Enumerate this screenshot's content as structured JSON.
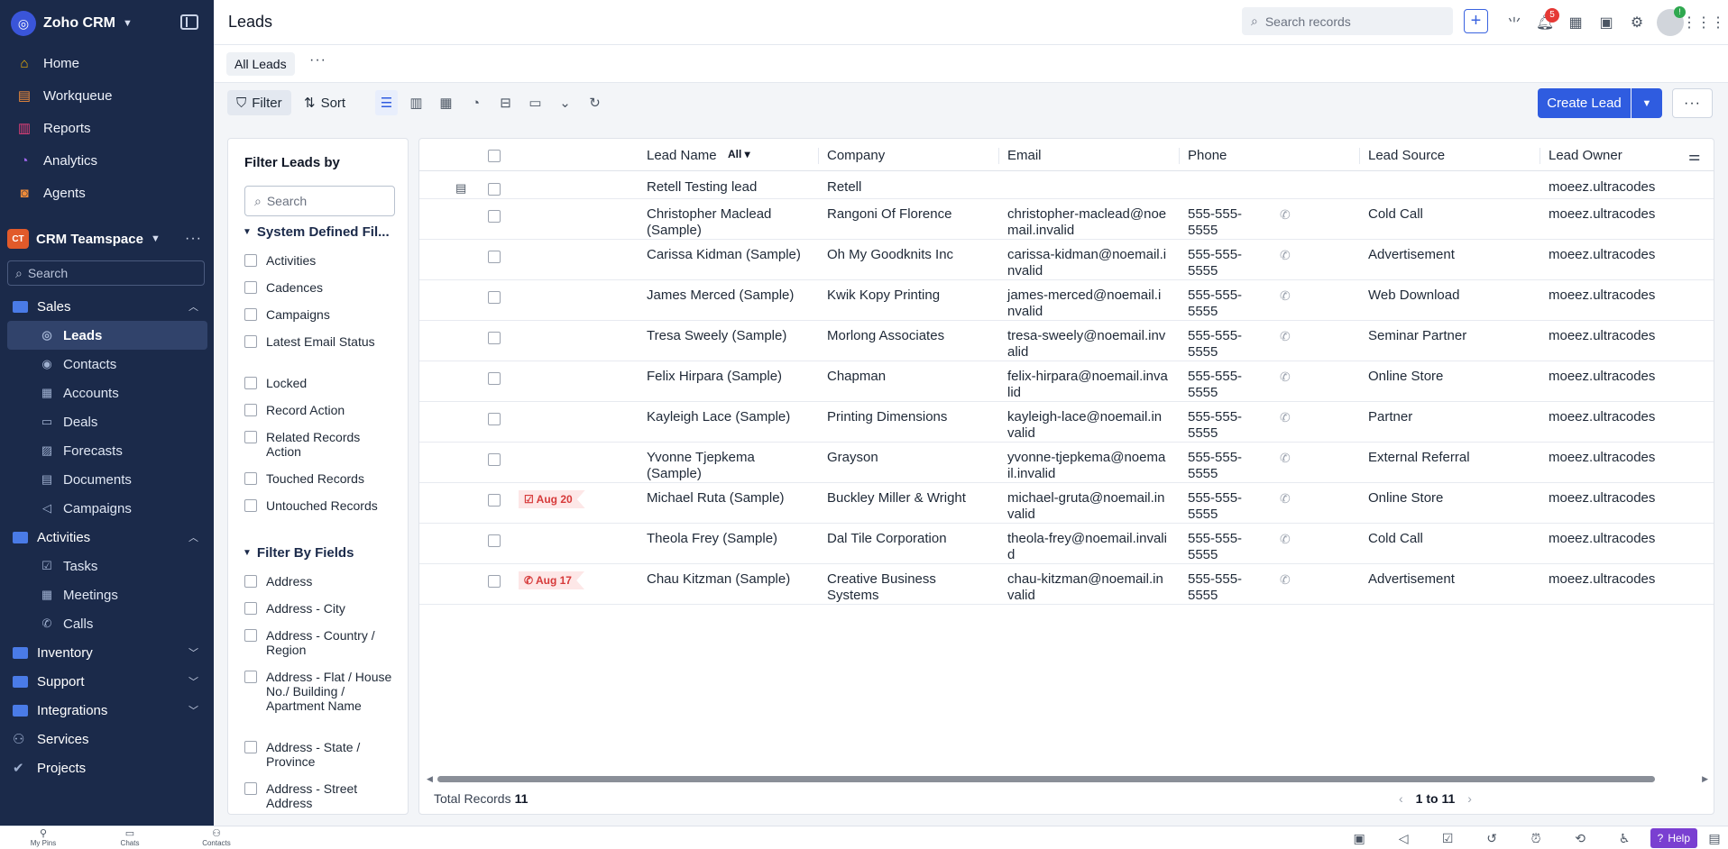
{
  "brand": {
    "name": "Zoho CRM"
  },
  "nav_top": [
    {
      "label": "Home",
      "icon": "home-icon",
      "glyph": "⌂",
      "color": "#f4b400"
    },
    {
      "label": "Workqueue",
      "icon": "workqueue-icon",
      "glyph": "▤",
      "color": "#f08c3a"
    },
    {
      "label": "Reports",
      "icon": "reports-icon",
      "glyph": "▥",
      "color": "#e8407a"
    },
    {
      "label": "Analytics",
      "icon": "analytics-icon",
      "glyph": "◔",
      "color": "#a067f0"
    },
    {
      "label": "Agents",
      "icon": "agents-icon",
      "glyph": "◙",
      "color": "#f08c3a"
    }
  ],
  "workspace": {
    "badge": "CT",
    "name": "CRM Teamspace"
  },
  "sidebar_search": {
    "placeholder": "Search"
  },
  "tree": {
    "sales": {
      "label": "Sales"
    },
    "sales_items": [
      {
        "label": "Leads",
        "icon": "leads-icon",
        "glyph": "◎",
        "active": true
      },
      {
        "label": "Contacts",
        "icon": "contacts-icon",
        "glyph": "◉",
        "active": false
      },
      {
        "label": "Accounts",
        "icon": "accounts-icon",
        "glyph": "▦",
        "active": false
      },
      {
        "label": "Deals",
        "icon": "deals-icon",
        "glyph": "▭",
        "active": false
      },
      {
        "label": "Forecasts",
        "icon": "forecasts-icon",
        "glyph": "▨",
        "active": false
      },
      {
        "label": "Documents",
        "icon": "documents-icon",
        "glyph": "▤",
        "active": false
      },
      {
        "label": "Campaigns",
        "icon": "campaigns-icon",
        "glyph": "◁",
        "active": false
      }
    ],
    "activities": {
      "label": "Activities"
    },
    "activities_items": [
      {
        "label": "Tasks",
        "icon": "tasks-icon",
        "glyph": "☑"
      },
      {
        "label": "Meetings",
        "icon": "meetings-icon",
        "glyph": "▦"
      },
      {
        "label": "Calls",
        "icon": "calls-icon",
        "glyph": "✆"
      }
    ],
    "inventory": {
      "label": "Inventory"
    },
    "support": {
      "label": "Support"
    },
    "integrations": {
      "label": "Integrations"
    },
    "services": {
      "label": "Services"
    },
    "projects": {
      "label": "Projects"
    }
  },
  "header": {
    "title": "Leads",
    "search_placeholder": "Search records",
    "notifications_count": "5",
    "avatar_badge": "!"
  },
  "tabs": {
    "active": "All Leads"
  },
  "toolbar": {
    "filter": "Filter",
    "sort": "Sort",
    "create": "Create Lead"
  },
  "filter_panel": {
    "title": "Filter Leads by",
    "search_placeholder": "Search",
    "section1": "System Defined Fil...",
    "section1_items": [
      "Activities",
      "Cadences",
      "Campaigns",
      "Latest Email Status",
      "Locked",
      "Record Action",
      "Related Records Action",
      "Touched Records",
      "Untouched Records"
    ],
    "section2": "Filter By Fields",
    "section2_items": [
      "Address",
      "Address - City",
      "Address - Country / Region",
      "Address - Flat / House No./ Building / Apartment Name",
      "Address - State / Province",
      "Address - Street Address"
    ]
  },
  "table": {
    "columns": [
      "Lead Name",
      "Company",
      "Email",
      "Phone",
      "Lead Source",
      "Lead Owner"
    ],
    "name_filter": "All",
    "rows": [
      {
        "name": "Retell Testing lead",
        "company": "Retell",
        "email": "",
        "phone": "",
        "source": "",
        "owner": "moeez.ultracodes",
        "tag": "",
        "note": true
      },
      {
        "name": "Christopher Maclead (Sample)",
        "company": "Rangoni Of Florence",
        "email": "christopher-maclead@noemail.invalid",
        "phone": "555-555-5555",
        "source": "Cold Call",
        "owner": "moeez.ultracodes",
        "tag": ""
      },
      {
        "name": "Carissa Kidman (Sample)",
        "company": "Oh My Goodknits Inc",
        "email": "carissa-kidman@noemail.invalid",
        "phone": "555-555-5555",
        "source": "Advertisement",
        "owner": "moeez.ultracodes",
        "tag": ""
      },
      {
        "name": "James Merced (Sample)",
        "company": "Kwik Kopy Printing",
        "email": "james-merced@noemail.invalid",
        "phone": "555-555-5555",
        "source": "Web Download",
        "owner": "moeez.ultracodes",
        "tag": ""
      },
      {
        "name": "Tresa Sweely (Sample)",
        "company": "Morlong Associates",
        "email": "tresa-sweely@noemail.invalid",
        "phone": "555-555-5555",
        "source": "Seminar Partner",
        "owner": "moeez.ultracodes",
        "tag": ""
      },
      {
        "name": "Felix Hirpara (Sample)",
        "company": "Chapman",
        "email": "felix-hirpara@noemail.invalid",
        "phone": "555-555-5555",
        "source": "Online Store",
        "owner": "moeez.ultracodes",
        "tag": ""
      },
      {
        "name": "Kayleigh Lace (Sample)",
        "company": "Printing Dimensions",
        "email": "kayleigh-lace@noemail.invalid",
        "phone": "555-555-5555",
        "source": "Partner",
        "owner": "moeez.ultracodes",
        "tag": ""
      },
      {
        "name": "Yvonne Tjepkema (Sample)",
        "company": "Grayson",
        "email": "yvonne-tjepkema@noemail.invalid",
        "phone": "555-555-5555",
        "source": "External Referral",
        "owner": "moeez.ultracodes",
        "tag": ""
      },
      {
        "name": "Michael Ruta (Sample)",
        "company": "Buckley Miller & Wright",
        "email": "michael-gruta@noemail.invalid",
        "phone": "555-555-5555",
        "source": "Online Store",
        "owner": "moeez.ultracodes",
        "tag": "Aug 20",
        "tag_icon": "☑"
      },
      {
        "name": "Theola Frey (Sample)",
        "company": "Dal Tile Corporation",
        "email": "theola-frey@noemail.invalid",
        "phone": "555-555-5555",
        "source": "Cold Call",
        "owner": "moeez.ultracodes",
        "tag": ""
      },
      {
        "name": "Chau Kitzman (Sample)",
        "company": "Creative Business Systems",
        "email": "chau-kitzman@noemail.invalid",
        "phone": "555-555-5555",
        "source": "Advertisement",
        "owner": "moeez.ultracodes",
        "tag": "Aug 17",
        "tag_icon": "✆"
      }
    ],
    "total_label": "Total Records",
    "total": "11",
    "page_range": "1 to 11"
  },
  "bottom_bar": {
    "items": [
      "My Pins",
      "Chats",
      "Contacts"
    ],
    "help": "Help"
  }
}
